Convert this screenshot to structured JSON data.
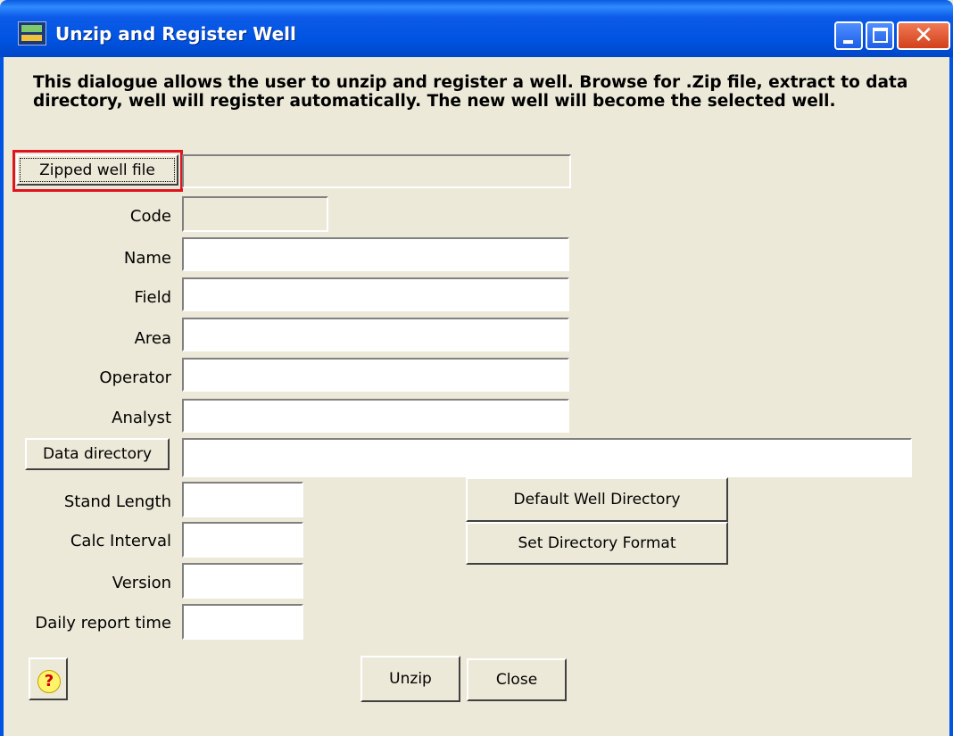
{
  "window": {
    "title": "Unzip and Register Well"
  },
  "description": "This dialogue allows the user to unzip and register a well. Browse for .Zip file, extract to data directory, well will register automatically. The new well will become the selected well.",
  "buttons": {
    "zipped_well_file": "Zipped well file",
    "data_directory": "Data directory",
    "default_well_directory": "Default Well Directory",
    "set_directory_format": "Set Directory Format",
    "unzip": "Unzip",
    "close": "Close",
    "help": "?"
  },
  "fields": {
    "code": {
      "label": "Code",
      "value": ""
    },
    "name": {
      "label": "Name",
      "value": ""
    },
    "field": {
      "label": "Field",
      "value": ""
    },
    "area": {
      "label": "Area",
      "value": ""
    },
    "operator": {
      "label": "Operator",
      "value": ""
    },
    "analyst": {
      "label": "Analyst",
      "value": ""
    },
    "data_directory": {
      "value": ""
    },
    "zipped_well_file": {
      "value": ""
    },
    "stand_length": {
      "label": "Stand Length",
      "value": ""
    },
    "calc_interval": {
      "label": "Calc Interval",
      "value": ""
    },
    "version": {
      "label": "Version",
      "value": ""
    },
    "daily_report_time": {
      "label": "Daily report time",
      "value": ""
    }
  },
  "icons": [
    "app-icon",
    "minimize-icon",
    "maximize-icon",
    "close-icon",
    "help-icon"
  ],
  "colors": {
    "highlight": "#e0141e",
    "titlebar": "#0053e1",
    "dialog_bg": "#ece9d8"
  }
}
